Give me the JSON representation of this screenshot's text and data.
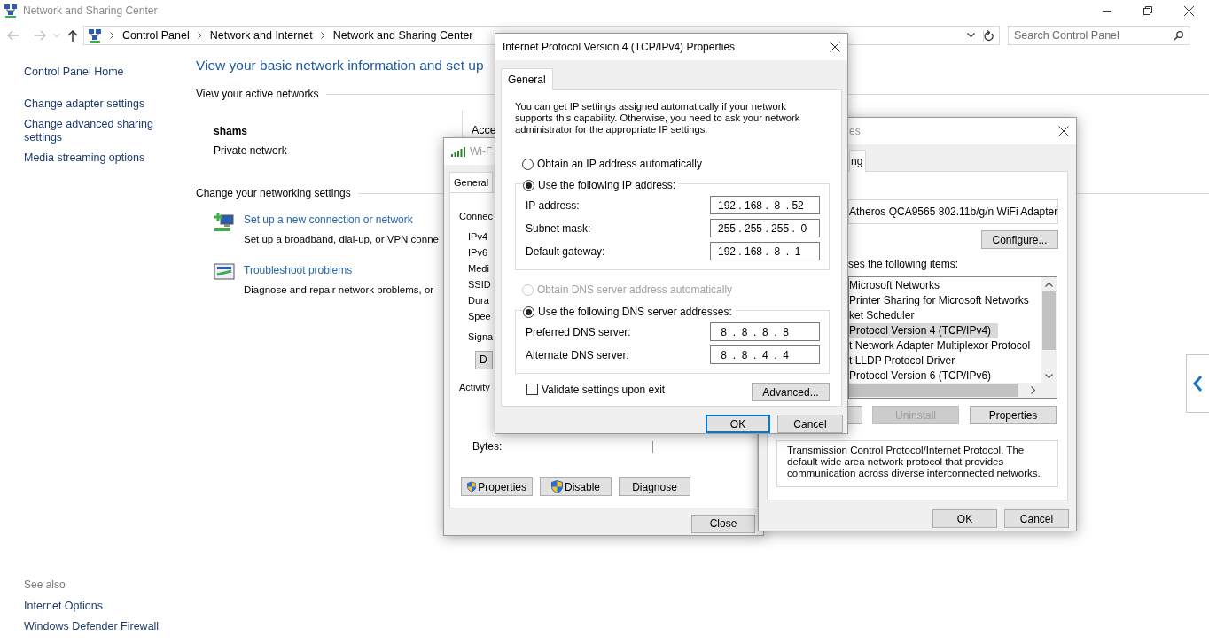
{
  "window": {
    "title": "Network and Sharing Center"
  },
  "address_bar": {
    "breadcrumbs": [
      "Control Panel",
      "Network and Internet",
      "Network and Sharing Center"
    ]
  },
  "search": {
    "placeholder": "Search Control Panel"
  },
  "sidebar": {
    "links": [
      "Control Panel Home",
      "Change adapter settings",
      "Change advanced sharing settings",
      "Media streaming options"
    ],
    "see_also": {
      "heading": "See also",
      "links": [
        "Internet Options",
        "Windows Defender Firewall"
      ]
    }
  },
  "main": {
    "heading": "View your basic network information and set up",
    "active_networks": {
      "heading": "View your active networks",
      "network_name": "shams",
      "network_type": "Private network",
      "column_2": "Acce"
    },
    "settings": {
      "heading": "Change your networking settings",
      "tasks": [
        {
          "link": "Set up a new connection or network",
          "description": "Set up a broadband, dial-up, or VPN conne"
        },
        {
          "link": "Troubleshoot problems",
          "description": "Diagnose and repair network problems, or"
        }
      ]
    }
  },
  "status_dialog": {
    "title": "Wi-F",
    "tab": "General",
    "connection_label": "Connec",
    "rows": [
      "IPv4",
      "IPv6",
      "Medi",
      "SSID",
      "Dura",
      "Spee"
    ],
    "signal_label": "Signa",
    "details_button": "D",
    "activity_label": "Activity",
    "bytes_label": "Bytes:",
    "buttons": [
      {
        "label": "Properties",
        "shield": true
      },
      {
        "label": "Disable",
        "shield": true
      },
      {
        "label": "Diagnose",
        "shield": false
      }
    ],
    "close_button": "Close"
  },
  "properties_dialog": {
    "title": "es",
    "tab": "ng",
    "adapter": "Atheros QCA9565 802.11b/g/n WiFi Adapter",
    "configure_button": "Configure...",
    "items_label": "ses the following items:",
    "items": [
      {
        "label": "Microsoft Networks",
        "selected": false
      },
      {
        "label": "Printer Sharing for Microsoft Networks",
        "selected": false
      },
      {
        "label": "ket Scheduler",
        "selected": false
      },
      {
        "label": "Protocol Version 4 (TCP/IPv4)",
        "selected": true
      },
      {
        "label": "t Network Adapter Multiplexor Protocol",
        "selected": false
      },
      {
        "label": "t LLDP Protocol Driver",
        "selected": false
      },
      {
        "label": "Protocol Version 6 (TCP/IPv6)",
        "selected": false
      }
    ],
    "buttons": [
      {
        "label": "Uninstall",
        "disabled": true
      },
      {
        "label": "Properties",
        "disabled": false
      }
    ],
    "description": "Transmission Control Protocol/Internet Protocol. The default wide area network protocol that provides communication across diverse interconnected networks.",
    "ok_button": "OK",
    "cancel_button": "Cancel"
  },
  "ipv4_dialog": {
    "title": "Internet Protocol Version 4 (TCP/IPv4) Properties",
    "tab": "General",
    "intro": "You can get IP settings assigned automatically if your network supports this capability. Otherwise, you need to ask your network administrator for the appropriate IP settings.",
    "ip_options": [
      {
        "label": "Obtain an IP address automatically",
        "selected": false,
        "disabled": false
      },
      {
        "label": "Use the following IP address:",
        "selected": true,
        "disabled": false
      }
    ],
    "ip_fields": [
      {
        "label": "IP address:",
        "value": "192 . 168 .  8  . 52"
      },
      {
        "label": "Subnet mask:",
        "value": "255 . 255 . 255 .  0"
      },
      {
        "label": "Default gateway:",
        "value": "192 . 168 .  8  .  1"
      }
    ],
    "dns_options": [
      {
        "label": "Obtain DNS server address automatically",
        "selected": false,
        "disabled": true
      },
      {
        "label": "Use the following DNS server addresses:",
        "selected": true,
        "disabled": false
      }
    ],
    "dns_fields": [
      {
        "label": "Preferred DNS server:",
        "value": " 8  .  8  .  8  .  8"
      },
      {
        "label": "Alternate DNS server:",
        "value": " 8  .  8  .  4  .  4"
      }
    ],
    "validate": {
      "label": "Validate settings upon exit",
      "checked": false
    },
    "advanced_button": "Advanced...",
    "ok_button": "OK",
    "cancel_button": "Cancel"
  }
}
